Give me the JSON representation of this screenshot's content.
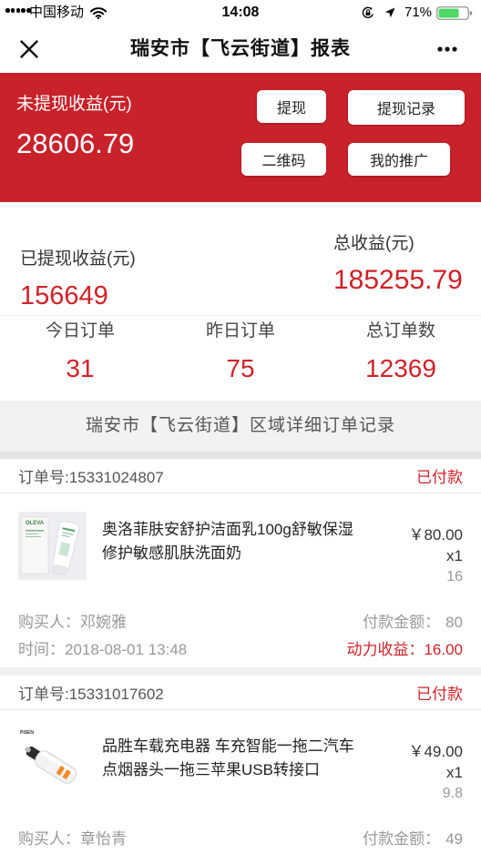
{
  "status_bar": {
    "carrier": "中国移动",
    "time": "14:08",
    "battery": "71%"
  },
  "nav": {
    "title": "瑞安市【飞云街道】报表",
    "close_icon": "close-icon",
    "more_icon": "more-icon"
  },
  "header": {
    "unwithdrawn_label": "未提现收益(元)",
    "unwithdrawn_value": "28606.79",
    "buttons": {
      "withdraw": "提现",
      "withdraw_records": "提现记录",
      "qr_code": "二维码",
      "my_promotion": "我的推广"
    }
  },
  "summary": {
    "withdrawn_label": "已提现收益(元)",
    "withdrawn_value": "156649",
    "total_label": "总收益(元)",
    "total_value": "185255.79"
  },
  "stats": [
    {
      "label": "今日订单",
      "value": "31"
    },
    {
      "label": "昨日订单",
      "value": "75"
    },
    {
      "label": "总订单数",
      "value": "12369"
    }
  ],
  "section_title": "瑞安市【飞云街道】区域详细订单记录",
  "orders": [
    {
      "order_no": "订单号:15331024807",
      "status": "已付款",
      "product": {
        "name": "奥洛菲肤安舒护洁面乳100g舒敏保湿修护敏感肌肤洗面奶",
        "price": "￥80.00",
        "quantity": "x1",
        "commission": "16",
        "image_brand": "OLEVA"
      },
      "buyer_label": "购买人：",
      "buyer": "邓婉雅",
      "amount_label": "付款金额：",
      "amount": "80",
      "time_label": "时间：",
      "time": "2018-08-01 13:48",
      "earnings_label": "动力收益：",
      "earnings": "16.00"
    },
    {
      "order_no": "订单号:15331017602",
      "status": "已付款",
      "product": {
        "name": "品胜车载充电器 车充智能一拖二汽车点烟器头一拖三苹果USB转接口",
        "price": "￥49.00",
        "quantity": "x1",
        "commission": "9.8",
        "image_brand": "PISEN"
      },
      "buyer_label": "购买人：",
      "buyer": "章怡青",
      "amount_label": "付款金额：",
      "amount": "49"
    }
  ],
  "colors": {
    "header_red": "#c8222b",
    "accent_red": "#cf2229",
    "battery_green": "#4cd964"
  }
}
